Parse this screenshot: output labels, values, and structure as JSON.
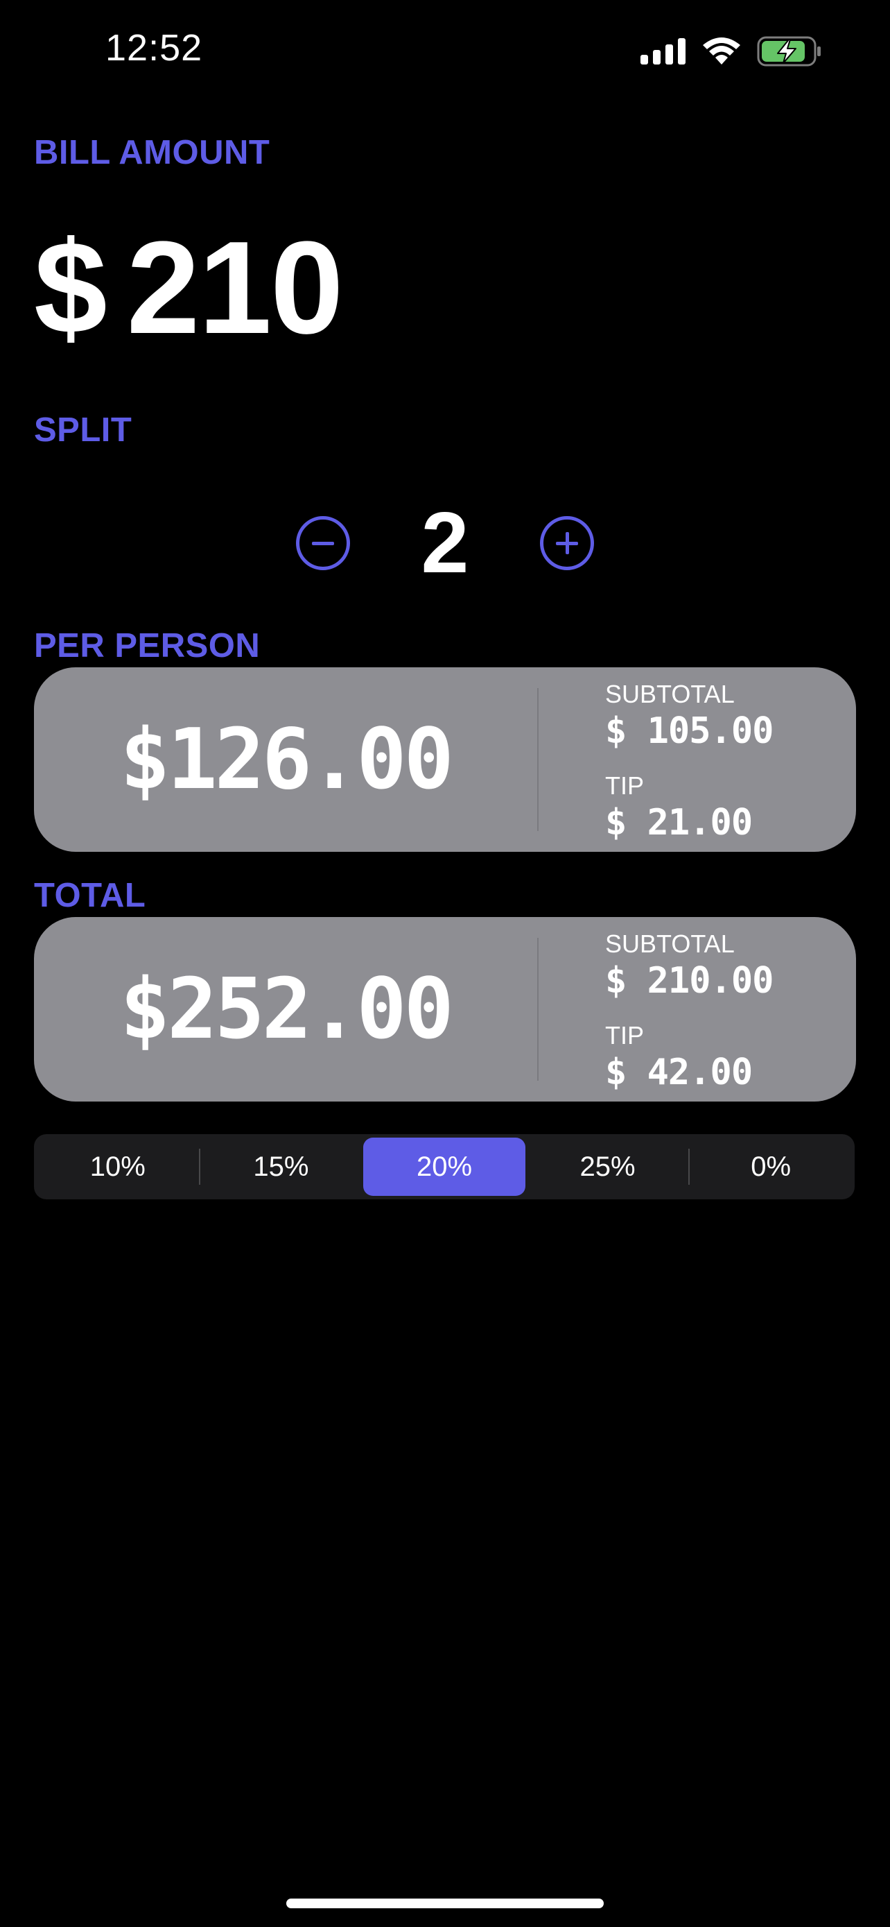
{
  "status_bar": {
    "time": "12:52"
  },
  "bill": {
    "label": "BILL AMOUNT",
    "currency": "$",
    "amount": "210"
  },
  "split": {
    "label": "SPLIT",
    "count": "2"
  },
  "per_person": {
    "label": "PER PERSON",
    "amount": "$126.00",
    "subtotal_label": "SUBTOTAL",
    "subtotal_value": "$ 105.00",
    "tip_label": "TIP",
    "tip_value": "$ 21.00"
  },
  "total": {
    "label": "TOTAL",
    "amount": "$252.00",
    "subtotal_label": "SUBTOTAL",
    "subtotal_value": "$ 210.00",
    "tip_label": "TIP",
    "tip_value": "$ 42.00"
  },
  "tip_options": {
    "items": [
      "10%",
      "15%",
      "20%",
      "25%",
      "0%"
    ],
    "selected": "20%"
  },
  "colors": {
    "accent": "#5E5CE6",
    "card_background": "#8E8E93",
    "segment_background": "#1C1C1E",
    "battery_green": "#65C466"
  },
  "icons": {
    "cellular": "cellular-signal-icon",
    "wifi": "wifi-icon",
    "battery": "battery-charging-icon",
    "decrement": "minus-circle-icon",
    "increment": "plus-circle-icon"
  }
}
